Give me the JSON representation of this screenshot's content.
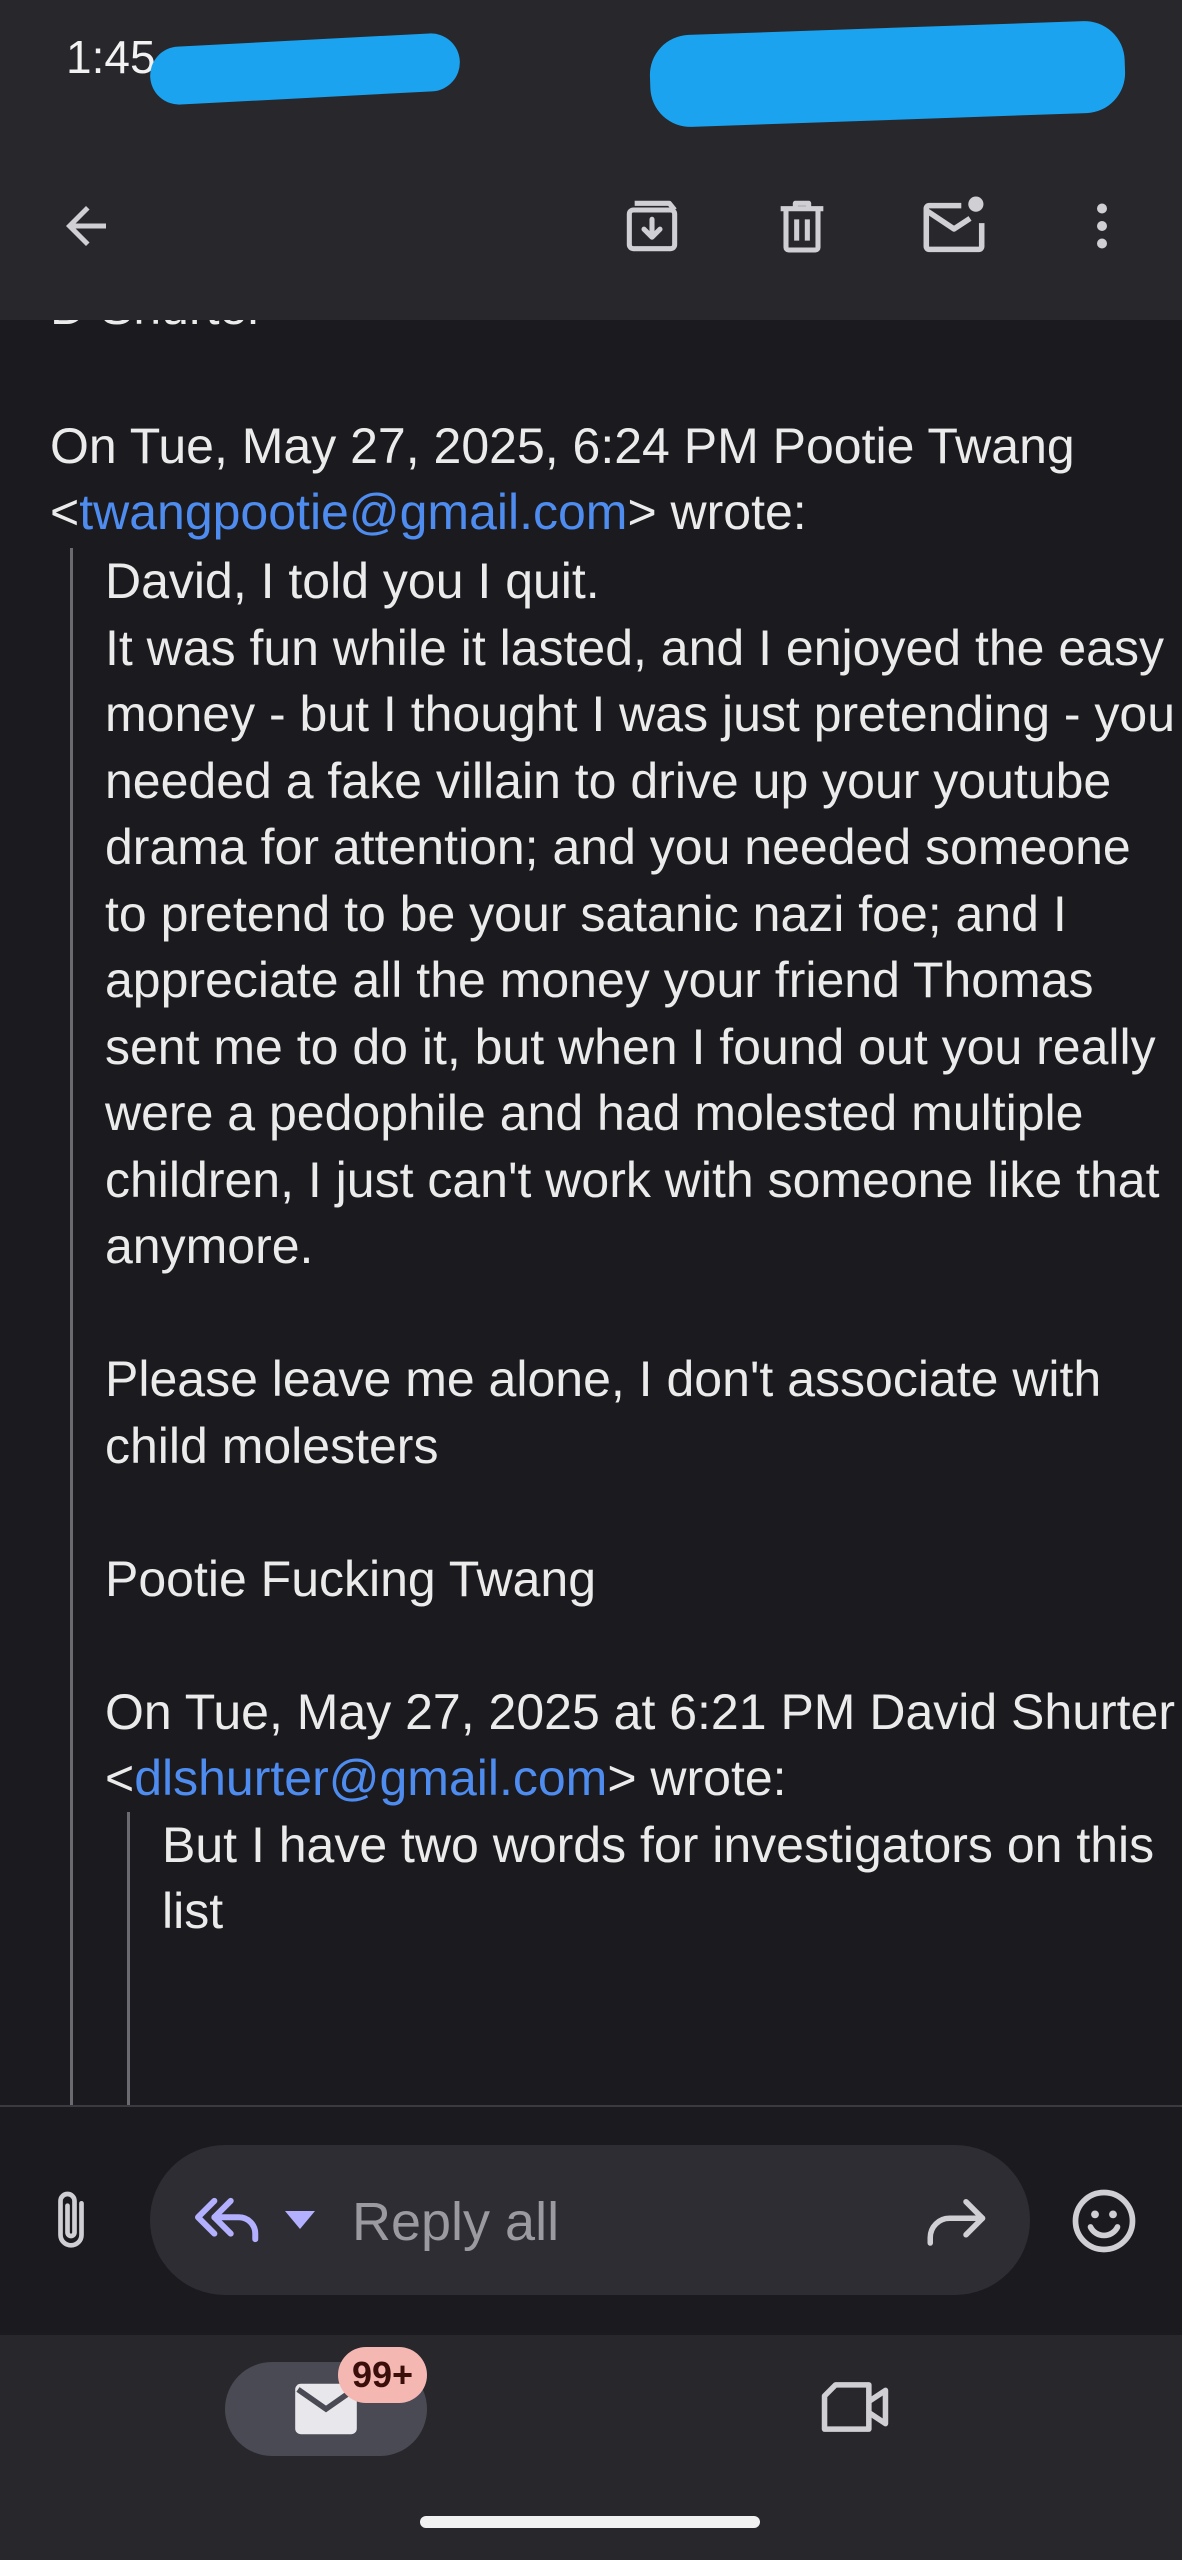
{
  "status_bar": {
    "time": "1:45"
  },
  "toolbar": {
    "back_icon": "arrow-back-icon",
    "archive_icon": "archive-icon",
    "delete_icon": "trash-icon",
    "mark_unread_icon": "mail-unread-icon",
    "more_icon": "more-vert-icon"
  },
  "email": {
    "cut_off_line": "D Shurter",
    "reply_header": {
      "prefix": "On Tue, May 27, 2025, 6:24 PM Pootie Twang <",
      "email": "twangpootie@gmail.com",
      "suffix": "> wrote:"
    },
    "quoted_paragraphs": [
      "David, I told you I quit.",
      "It was fun while it lasted, and I enjoyed the easy money - but I thought I was just pretending - you needed a fake villain to drive up your youtube drama for attention; and you needed someone to pretend to be your satanic nazi foe; and I appreciate all the money your friend Thomas sent me to do it, but when I found out you really were a pedophile and had molested multiple children, I just can't work with someone like that anymore.",
      "Please leave me alone, I don't associate with child molesters",
      "Pootie Fucking Twang"
    ],
    "nested_header": {
      "prefix": "On Tue, May 27, 2025 at 6:21 PM David Shurter <",
      "email": "dlshurter@gmail.com",
      "suffix": "> wrote:"
    },
    "nested_text": "But I have two words for investigators on this list"
  },
  "reply_bar": {
    "placeholder": "Reply all",
    "attach_icon": "paperclip-icon",
    "reply_all_icon": "reply-all-icon",
    "dropdown_icon": "caret-down-icon",
    "forward_icon": "forward-icon",
    "emoji_icon": "emoji-icon"
  },
  "bottom_nav": {
    "mail_icon": "mail-icon",
    "badge": "99+",
    "meet_icon": "video-camera-icon"
  }
}
